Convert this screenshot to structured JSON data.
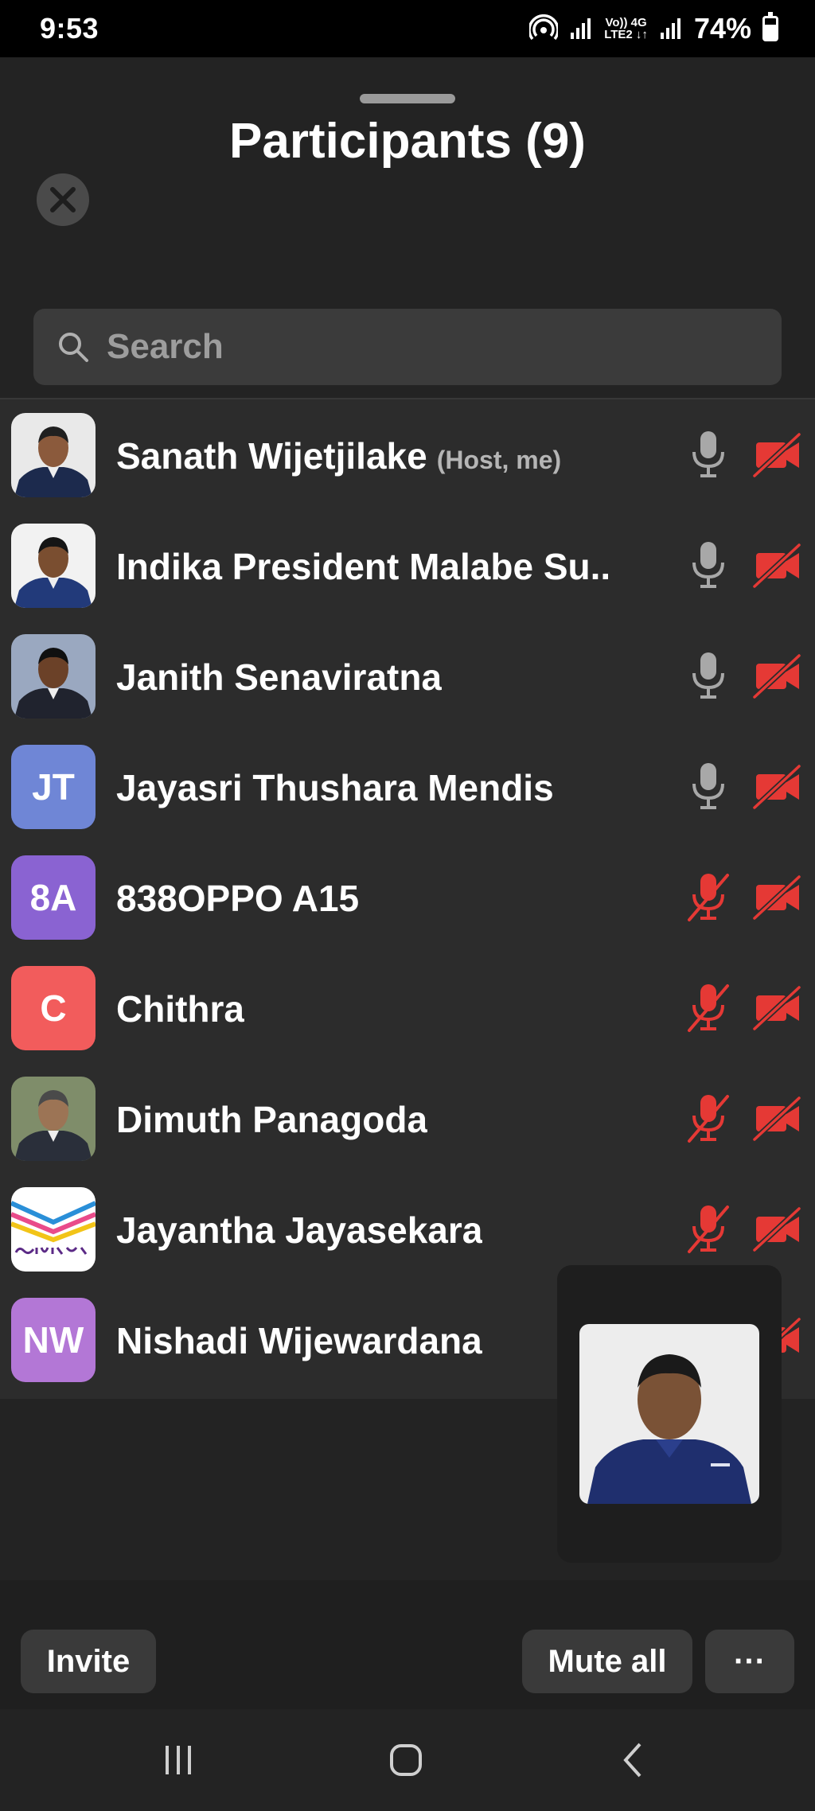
{
  "status_bar": {
    "time": "9:53",
    "network_top": "Vo)) 4G",
    "network_bottom": "LTE2 ↓↑",
    "battery": "74%"
  },
  "header": {
    "title": "Participants (9)"
  },
  "search": {
    "placeholder": "Search"
  },
  "colors": {
    "muted_red": "#e53935",
    "active_gray": "#a8a8a8",
    "background": "#2c2c2c"
  },
  "participants": [
    {
      "name": "Sanath Wijetjilake",
      "tag": "(Host, me)",
      "initials": "",
      "avatar_color": "",
      "avatar": "photo",
      "mic": "unmuted",
      "video": "off"
    },
    {
      "name": "Indika President Malabe Su...",
      "tag": "",
      "initials": "",
      "avatar_color": "",
      "avatar": "photo",
      "mic": "unmuted",
      "video": "off"
    },
    {
      "name": "Janith Senaviratna",
      "tag": "",
      "initials": "",
      "avatar_color": "",
      "avatar": "photo",
      "mic": "unmuted",
      "video": "off"
    },
    {
      "name": "Jayasri Thushara Mendis",
      "tag": "",
      "initials": "JT",
      "avatar_color": "#6f86d6",
      "avatar": "initials",
      "mic": "unmuted",
      "video": "off"
    },
    {
      "name": "838OPPO A15",
      "tag": "",
      "initials": "8A",
      "avatar_color": "#8a63d2",
      "avatar": "initials",
      "mic": "muted",
      "video": "off"
    },
    {
      "name": "Chithra",
      "tag": "",
      "initials": "C",
      "avatar_color": "#f25c5c",
      "avatar": "initials",
      "mic": "muted",
      "video": "off"
    },
    {
      "name": "Dimuth Panagoda",
      "tag": "",
      "initials": "",
      "avatar_color": "",
      "avatar": "photo",
      "mic": "muted",
      "video": "off"
    },
    {
      "name": "Jayantha Jayasekara",
      "tag": "",
      "initials": "",
      "avatar_color": "",
      "avatar": "logo",
      "mic": "muted",
      "video": "off"
    },
    {
      "name": "Nishadi Wijewardana",
      "tag": "",
      "initials": "NW",
      "avatar_color": "#b377d6",
      "avatar": "initials",
      "mic": "hidden",
      "video": "off"
    }
  ],
  "bottom_bar": {
    "invite_label": "Invite",
    "mute_all_label": "Mute all",
    "more_label": "···"
  }
}
